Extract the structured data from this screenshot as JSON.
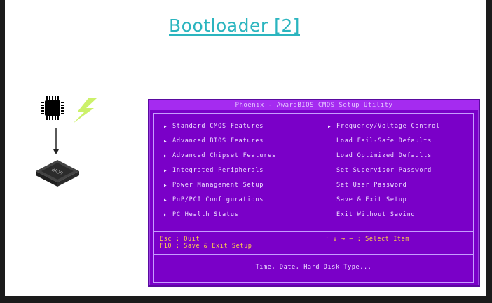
{
  "slide": {
    "title": "Bootloader [2]"
  },
  "icons": {
    "cpu": "cpu-chip-icon",
    "bolt": "lightning-bolt-icon",
    "arrow": "down-arrow-icon",
    "bios_chip": "bios-chip-icon",
    "bios_chip_label": "BIOS"
  },
  "bios": {
    "header": "Phoenix - AwardBIOS CMOS Setup Utility",
    "left_menu": [
      "Standard CMOS Features",
      "Advanced BIOS Features",
      "Advanced Chipset Features",
      "Integrated Peripherals",
      "Power Management Setup",
      "PnP/PCI Configurations",
      "PC Health Status"
    ],
    "right_menu": [
      {
        "label": "Frequency/Voltage Control",
        "arrow": true
      },
      {
        "label": "Load Fail-Safe Defaults",
        "arrow": false
      },
      {
        "label": "Load Optimized Defaults",
        "arrow": false
      },
      {
        "label": "Set Supervisor Password",
        "arrow": false
      },
      {
        "label": "Set User Password",
        "arrow": false
      },
      {
        "label": "Save & Exit Setup",
        "arrow": false
      },
      {
        "label": "Exit Without Saving",
        "arrow": false
      }
    ],
    "footer": {
      "esc": "Esc : Quit",
      "f10": "F10 : Save & Exit Setup",
      "select": "↑ ↓ → ←   : Select Item",
      "help": "Time, Date, Hard Disk Type..."
    }
  },
  "colors": {
    "title": "#2bb5bf",
    "bios_bg": "#7a00c8",
    "bios_header": "#a52bf0",
    "footer_text": "#ffd24a"
  }
}
